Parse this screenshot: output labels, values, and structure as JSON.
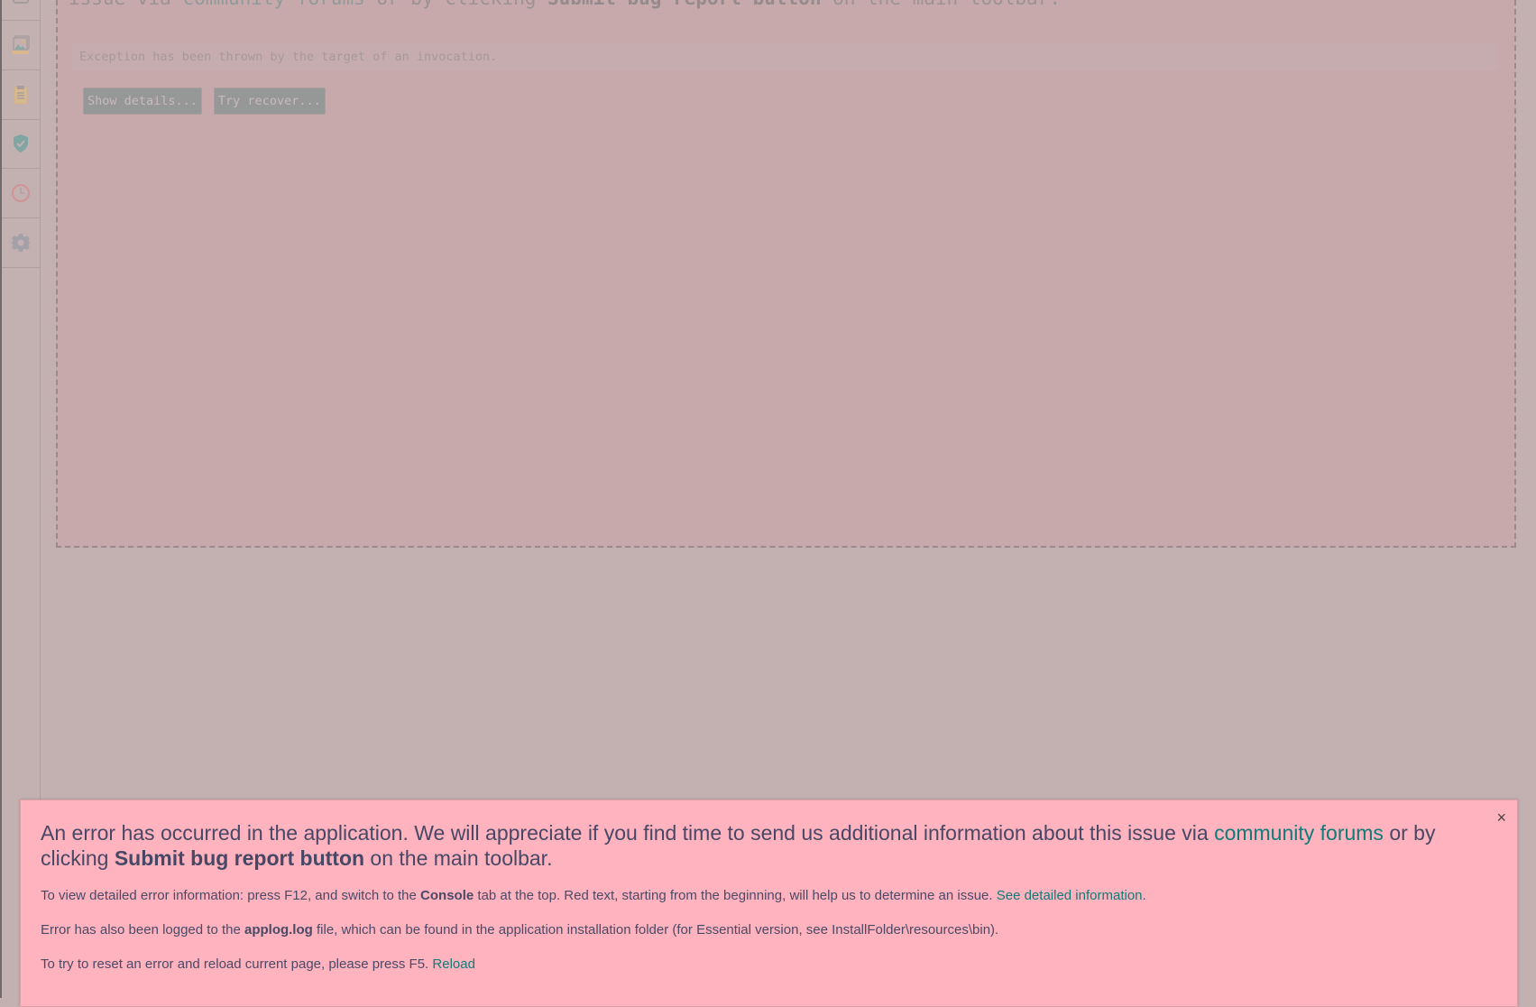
{
  "sidebar": {
    "items": [
      {
        "icon": "box-icon"
      },
      {
        "icon": "gallery-icon"
      },
      {
        "icon": "clipboard-icon"
      },
      {
        "icon": "shield-check-icon"
      },
      {
        "icon": "clock-icon"
      },
      {
        "icon": "gear-icon"
      }
    ]
  },
  "error_panel": {
    "title_prefix": "issue via ",
    "title_link": "community forums",
    "title_mid": " or by clicking ",
    "title_bold": "Submit bug report button",
    "title_suffix": " on the main toolbar.",
    "exception_message": "Exception has been thrown by the target of an invocation.",
    "show_details_label": "Show details...",
    "try_recover_label": "Try recover..."
  },
  "banner": {
    "close_label": "×",
    "head_prefix": "An error has occurred in the application. We will appreciate if you find time to send us additional information about this issue via ",
    "head_link": "community forums",
    "head_mid": " or by clicking ",
    "head_bold": "Submit bug report button",
    "head_suffix": " on the main toolbar.",
    "line1_prefix": "To view detailed error information: press F12, and switch to the ",
    "line1_bold": "Console",
    "line1_mid": " tab at the top. Red text, starting from the beginning, will help us to determine an issue. ",
    "line1_link": "See detailed information",
    "line1_suffix": ".",
    "line2_prefix": "Error has also been logged to the ",
    "line2_bold": "applog.log",
    "line2_suffix": " file, which can be found in the application installation folder (for Essential version, see InstallFolder\\resources\\bin).",
    "line3_prefix": "To try to reset an error and reload current page, please press F5. ",
    "line3_link": "Reload"
  },
  "colors": {
    "link": "#117b78",
    "banner_bg": "#ffb3be",
    "overlay_bg": "#c3b1b2"
  }
}
